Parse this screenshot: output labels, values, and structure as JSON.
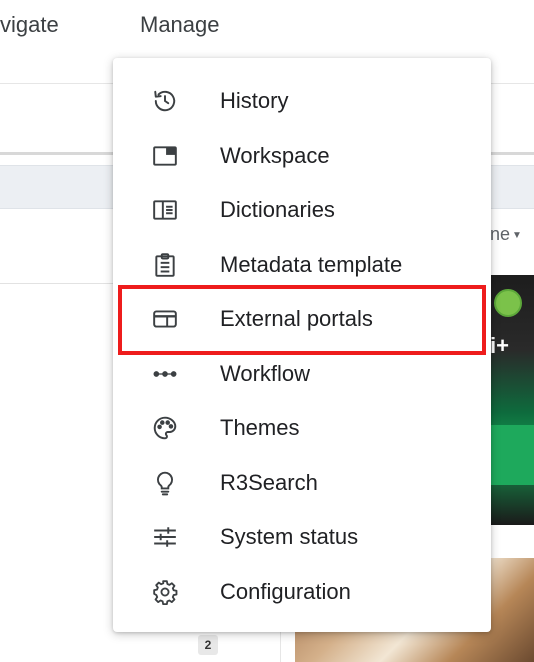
{
  "topnav": {
    "navigate_label": "vigate",
    "manage_label": "Manage"
  },
  "background": {
    "sort_label": "ne",
    "page_badge": "2"
  },
  "menu": {
    "items": [
      {
        "label": "History",
        "icon": "history-icon"
      },
      {
        "label": "Workspace",
        "icon": "workspace-icon"
      },
      {
        "label": "Dictionaries",
        "icon": "dictionaries-icon"
      },
      {
        "label": "Metadata template",
        "icon": "clipboard-icon"
      },
      {
        "label": "External portals",
        "icon": "portal-icon"
      },
      {
        "label": "Workflow",
        "icon": "workflow-dots-icon"
      },
      {
        "label": "Themes",
        "icon": "palette-icon"
      },
      {
        "label": "R3Search",
        "icon": "lightbulb-icon"
      },
      {
        "label": "System status",
        "icon": "sliders-icon"
      },
      {
        "label": "Configuration",
        "icon": "gear-icon"
      }
    ],
    "highlighted_item": "External portals"
  },
  "colors": {
    "highlight_border": "#ee1c1c",
    "icon": "#3c4043"
  }
}
